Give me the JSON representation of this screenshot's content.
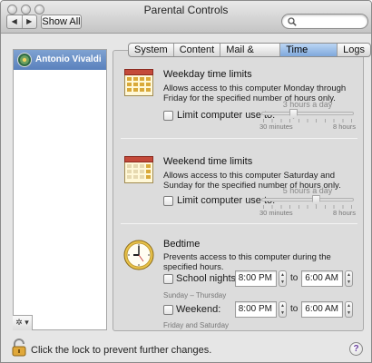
{
  "window": {
    "title": "Parental Controls"
  },
  "toolbar": {
    "back_glyph": "◀",
    "forward_glyph": "▶",
    "show_all_label": "Show All",
    "search_placeholder": ""
  },
  "sidebar": {
    "users": [
      {
        "name": "Antonio Vivaldi"
      }
    ],
    "gear_glyph": "✲ ▾"
  },
  "tabs": [
    {
      "label": "System",
      "active": false
    },
    {
      "label": "Content",
      "active": false
    },
    {
      "label": "Mail & iChat",
      "active": false
    },
    {
      "label": "Time Limits",
      "active": true
    },
    {
      "label": "Logs",
      "active": false
    }
  ],
  "weekday": {
    "title": "Weekday time limits",
    "description": "Allows access to this computer Monday through Friday for the specified number of hours only.",
    "checkbox_label": "Limit computer use to:",
    "checked": false,
    "slider_value": "3 hours a day",
    "slider_level_hours": 3,
    "slider_min": "30 minutes",
    "slider_max": "8 hours"
  },
  "weekend": {
    "title": "Weekend time limits",
    "description": "Allows access to this computer Saturday and Sunday for the specified number of hours only.",
    "checkbox_label": "Limit computer use to:",
    "checked": false,
    "slider_value": "5 hours a day",
    "slider_level_hours": 5,
    "slider_min": "30 minutes",
    "slider_max": "8 hours"
  },
  "bedtime": {
    "title": "Bedtime",
    "description": "Prevents access to this computer during the specified hours.",
    "school_nights": {
      "label": "School nights:",
      "sub": "Sunday – Thursday",
      "from": "8:00 PM",
      "to": "6:00 AM",
      "checked": false
    },
    "weekend": {
      "label": "Weekend:",
      "sub": "Friday and Saturday",
      "from": "8:00 PM",
      "to": "6:00 AM",
      "checked": false
    },
    "to_label": "to"
  },
  "footer": {
    "lock_text": "Click the lock to prevent further changes.",
    "help_glyph": "?"
  },
  "colors": {
    "selection": "#6a8fc8",
    "active_tab": "#9cc0ec",
    "panel": "#dcdcdc"
  }
}
